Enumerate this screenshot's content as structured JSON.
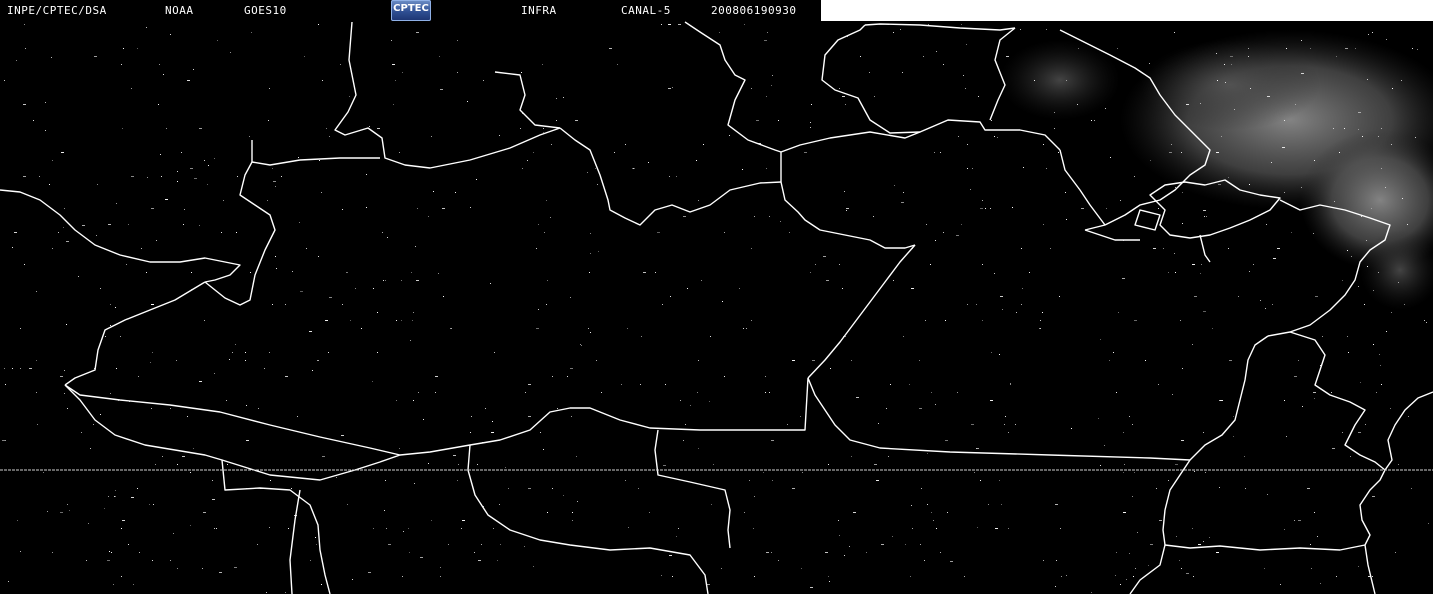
{
  "header": {
    "institution": "INPE/CPTEC/DSA",
    "agency": "NOAA",
    "satellite": "GOES10",
    "logo_text": "CPTEC",
    "image_type": "INFRA",
    "channel": "CANAL-5",
    "timestamp": "200806190930"
  },
  "colors": {
    "background": "#000000",
    "borders": "#ffffff",
    "clouds": "#7a7a7a"
  }
}
